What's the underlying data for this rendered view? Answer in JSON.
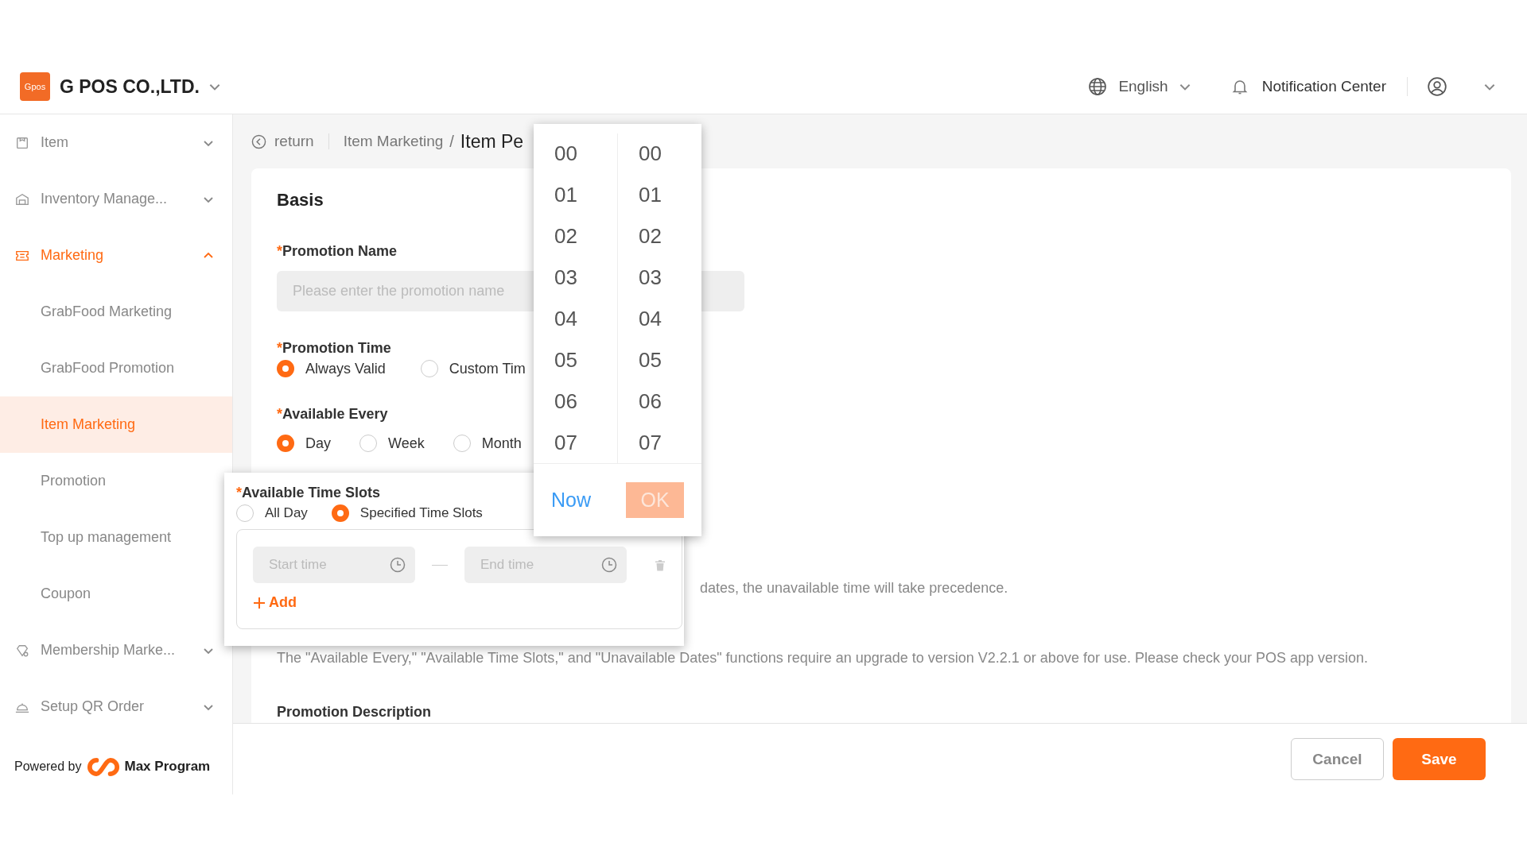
{
  "header": {
    "logo_text": "Gpos",
    "company": "G POS CO.,LTD.",
    "language": "English",
    "notification": "Notification Center"
  },
  "sidebar": {
    "items": [
      {
        "kind": "group",
        "label": "Item",
        "expanded": false,
        "selected": false
      },
      {
        "kind": "group",
        "label": "Inventory Manage...",
        "expanded": false,
        "selected": false
      },
      {
        "kind": "group",
        "label": "Marketing",
        "expanded": true,
        "selected": true,
        "children": [
          {
            "label": "GrabFood Marketing",
            "selected": false
          },
          {
            "label": "GrabFood Promotion",
            "selected": false
          },
          {
            "label": "Item Marketing",
            "selected": true
          },
          {
            "label": "Promotion",
            "selected": false
          },
          {
            "label": "Top up management",
            "selected": false
          },
          {
            "label": "Coupon",
            "selected": false
          }
        ]
      },
      {
        "kind": "group",
        "label": "Membership Marke...",
        "expanded": false,
        "selected": false
      },
      {
        "kind": "group",
        "label": "Setup QR Order",
        "expanded": false,
        "selected": false
      }
    ],
    "powered_by": "Powered by",
    "brand": "Max Program"
  },
  "breadcrumb": {
    "back": "return",
    "parent": "Item Marketing",
    "separator": "/",
    "current": "Item Pe"
  },
  "form": {
    "section": "Basis",
    "promotion_name": {
      "mark": "*",
      "label": "Promotion Name",
      "placeholder": "Please enter the promotion name"
    },
    "promotion_time": {
      "mark": "*",
      "label": "Promotion Time",
      "options": [
        {
          "label": "Always Valid",
          "selected": true
        },
        {
          "label": "Custom Tim",
          "selected": false
        }
      ]
    },
    "available_every": {
      "mark": "*",
      "label": "Available Every",
      "options": [
        {
          "label": "Day",
          "selected": true
        },
        {
          "label": "Week",
          "selected": false
        },
        {
          "label": "Month",
          "selected": false
        }
      ]
    },
    "notes": [
      "dates, the unavailable time will take precedence.",
      "The \"Available Every,\" \"Available Time Slots,\" and \"Unavailable Dates\" functions require an upgrade to version V2.2.1 or above for use. Please check your POS app version."
    ],
    "description_label": "Promotion Description"
  },
  "time_slots": {
    "mark": "*",
    "label": "Available Time Slots",
    "options": [
      {
        "label": "All Day",
        "selected": false
      },
      {
        "label": "Specified Time Slots",
        "selected": true
      }
    ],
    "slots": [
      {
        "start_placeholder": "Start time",
        "end_placeholder": "End time"
      }
    ],
    "add": "Add"
  },
  "time_picker": {
    "hours": [
      "00",
      "01",
      "02",
      "03",
      "04",
      "05",
      "06",
      "07"
    ],
    "minutes": [
      "00",
      "01",
      "02",
      "03",
      "04",
      "05",
      "06",
      "07"
    ],
    "now": "Now",
    "ok": "OK",
    "ok_disabled": true
  },
  "footer": {
    "cancel": "Cancel",
    "save": "Save"
  }
}
